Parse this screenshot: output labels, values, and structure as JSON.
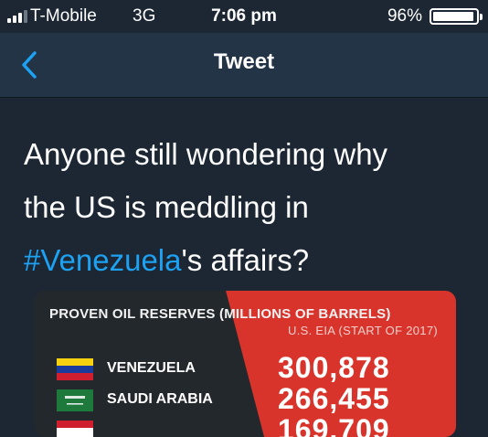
{
  "status_bar": {
    "carrier": "T-Mobile",
    "network": "3G",
    "time": "7:06 pm",
    "battery": "96%",
    "battery_level": 0.96
  },
  "nav": {
    "title": "Tweet",
    "back_icon": "chevron-left-icon"
  },
  "tweet": {
    "line1": "Anyone still wondering why",
    "line2": "the US is meddling in",
    "hashtag": "#Venezuela",
    "line3_rest": "'s affairs?"
  },
  "infographic": {
    "title": "PROVEN OIL RESERVES (MILLIONS OF BARRELS)",
    "subtitle": "U.S. EIA (START OF 2017)",
    "rows": [
      {
        "country": "VENEZUELA",
        "value": "300,878"
      },
      {
        "country": "SAUDI ARABIA",
        "value": "266,455"
      },
      {
        "country": "",
        "value": "169,709"
      }
    ],
    "colors": {
      "red": "#d9342b",
      "dark": "#22272b"
    }
  }
}
